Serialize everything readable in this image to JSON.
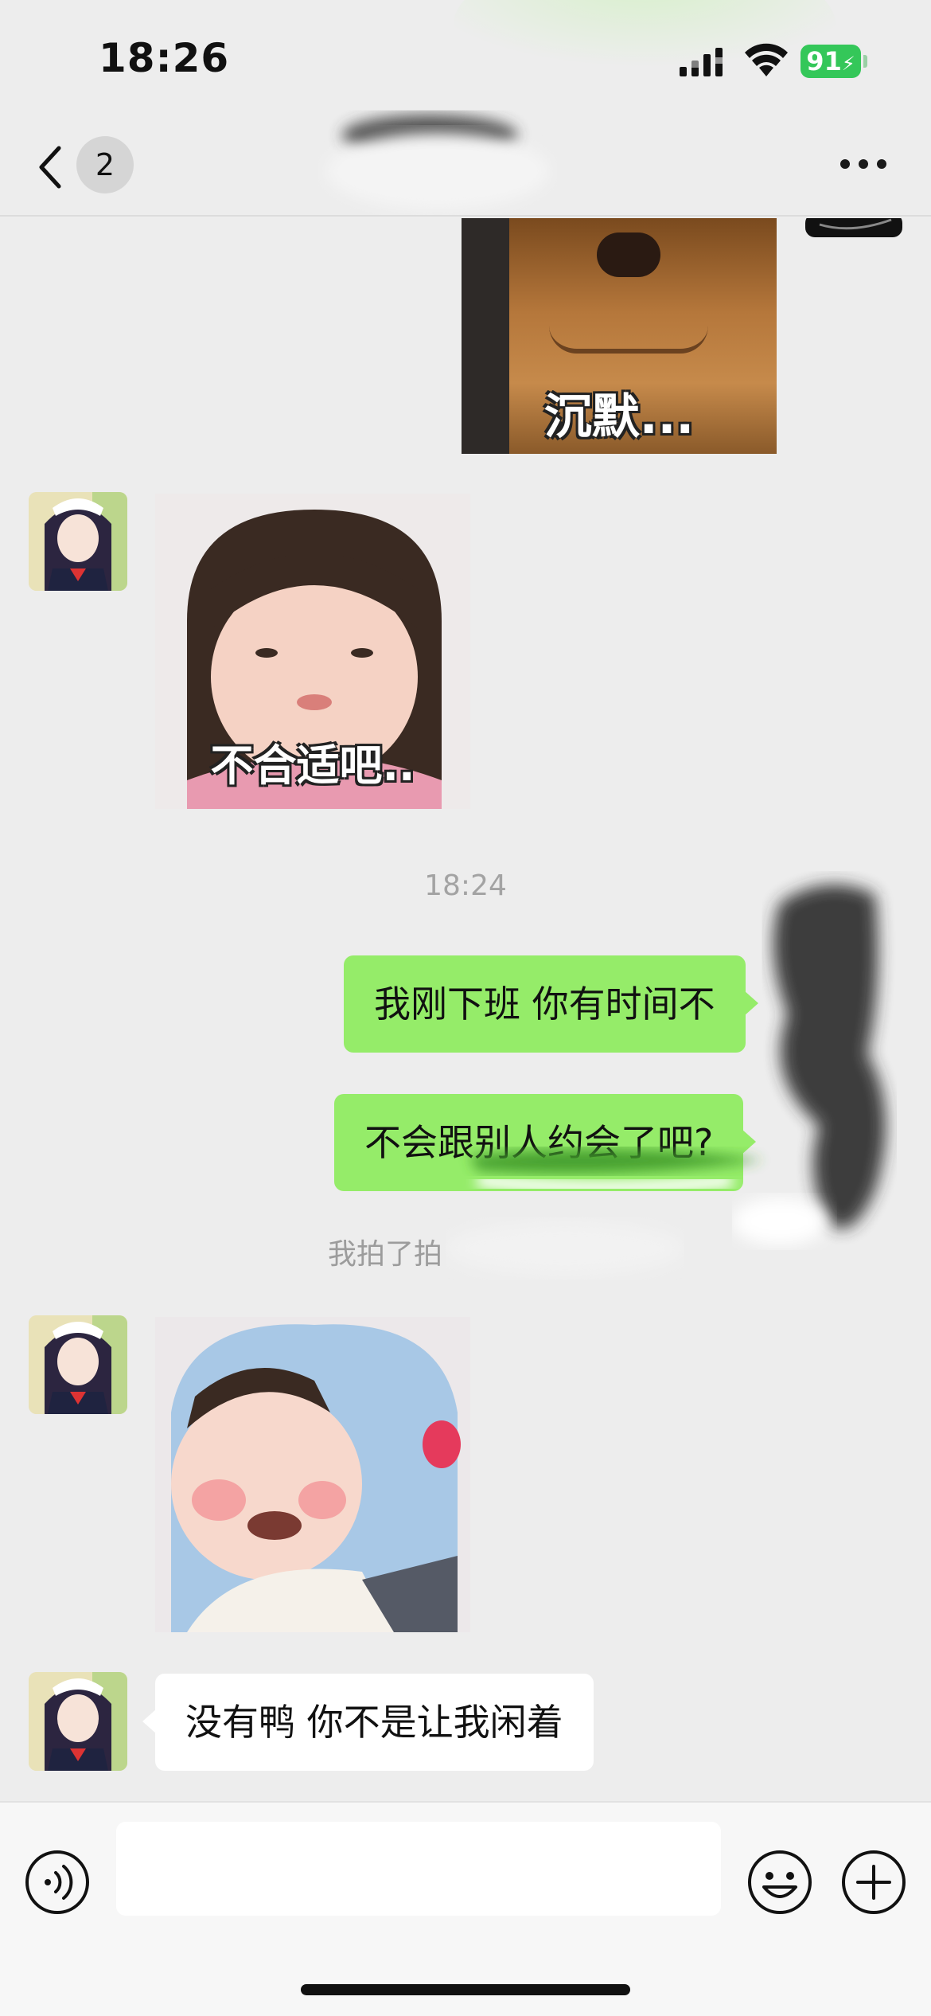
{
  "status_bar": {
    "time": "18:26",
    "battery": "91"
  },
  "nav": {
    "unread_count": "2"
  },
  "messages": [
    {
      "sender": "me",
      "type": "sticker",
      "caption": "沉默..."
    },
    {
      "sender": "other",
      "type": "sticker",
      "caption": "不合适吧.."
    },
    {
      "type": "timestamp",
      "text": "18:24"
    },
    {
      "sender": "me",
      "type": "text",
      "text": "我刚下班 你有时间不"
    },
    {
      "sender": "me",
      "type": "text",
      "text": "不会跟别人约会了吧?"
    },
    {
      "type": "system",
      "text": "我拍了拍"
    },
    {
      "sender": "other",
      "type": "sticker",
      "caption": ""
    },
    {
      "sender": "other",
      "type": "text",
      "text": "没有鸭 你不是让我闲着"
    }
  ],
  "input_bar": {
    "placeholder": ""
  },
  "icons": {
    "back": "chevron-left-icon",
    "more": "more-dots-icon",
    "voice": "voice-icon",
    "emoji": "emoji-icon",
    "plus": "plus-icon"
  },
  "colors": {
    "my_bubble": "#95ec69",
    "their_bubble": "#ffffff",
    "background": "#ededed",
    "battery": "#34c759"
  }
}
